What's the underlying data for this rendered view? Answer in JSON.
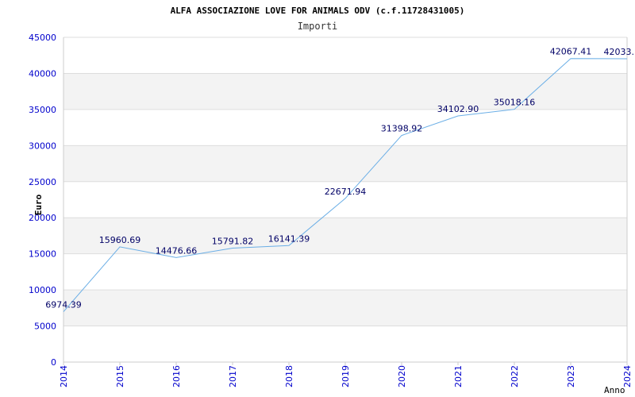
{
  "chart_data": {
    "type": "line",
    "title": "ALFA ASSOCIAZIONE LOVE FOR ANIMALS ODV (c.f.11728431005)",
    "subtitle": "Importi",
    "xlabel": "Anno",
    "ylabel": "Euro",
    "x": [
      "2014",
      "2015",
      "2016",
      "2017",
      "2018",
      "2019",
      "2020",
      "2021",
      "2022",
      "2023",
      "2024"
    ],
    "values": [
      6974.39,
      15960.69,
      14476.66,
      15791.82,
      16141.39,
      22671.94,
      31398.92,
      34102.9,
      35018.16,
      42067.41,
      42033.0
    ],
    "data_labels": [
      "6974.39",
      "15960.69",
      "14476.66",
      "15791.82",
      "16141.39",
      "22671.94",
      "31398.92",
      "34102.90",
      "35018.16",
      "42067.41",
      "42033."
    ],
    "ylim": [
      0,
      45000
    ],
    "yticks": [
      "0",
      "5000",
      "10000",
      "15000",
      "20000",
      "25000",
      "30000",
      "35000",
      "40000",
      "45000"
    ],
    "grid": true,
    "colors": {
      "line": "#6aaee6",
      "tick_text": "#0000cc",
      "label_text": "#000066",
      "band": "#f3f3f3",
      "gridline": "#dddddd",
      "axis": "#cccccc"
    }
  }
}
